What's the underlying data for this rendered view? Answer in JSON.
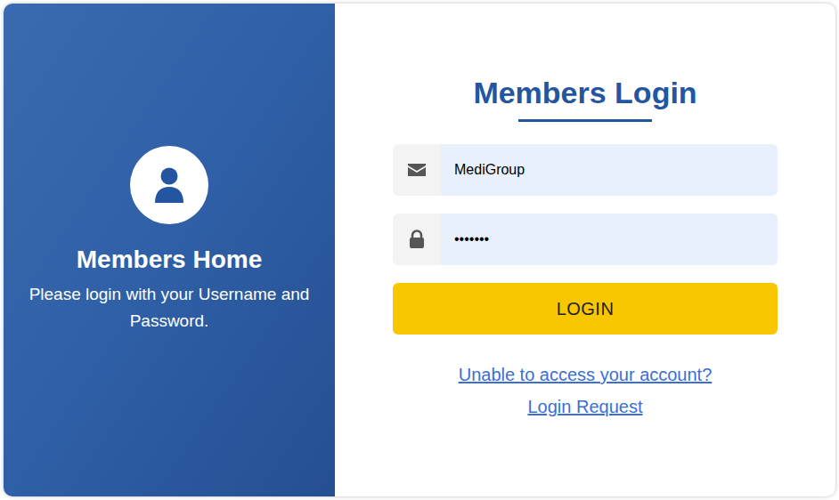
{
  "side_panel": {
    "title": "Members Home",
    "subtitle": "Please login with your Username and Password."
  },
  "login_form": {
    "title": "Members Login",
    "username": {
      "value": "MediGroup"
    },
    "password": {
      "value": "•••••••"
    },
    "button": "LOGIN",
    "links": [
      "Unable to access your account?",
      "Login Request"
    ]
  }
}
